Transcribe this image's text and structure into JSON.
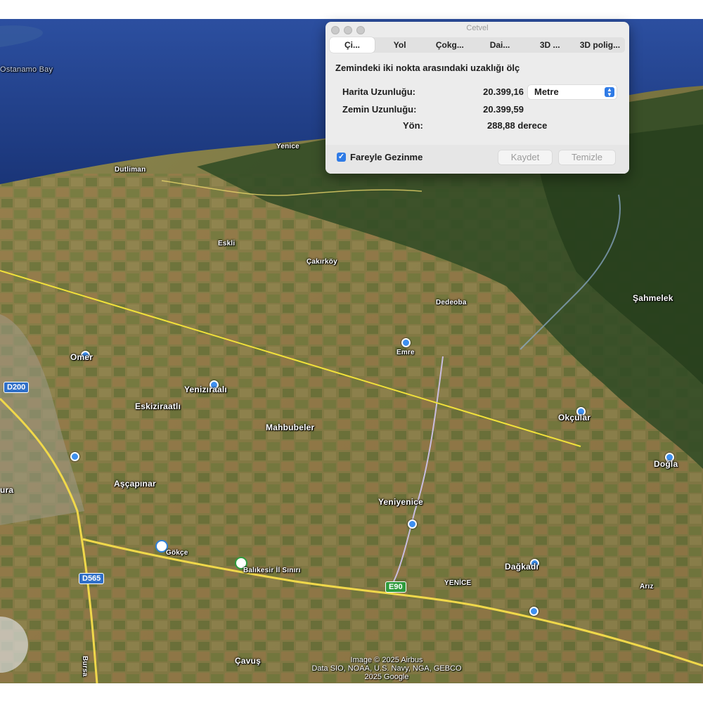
{
  "ruler": {
    "window_title": "Cetvel",
    "tabs": [
      "Çi...",
      "Yol",
      "Çokg...",
      "Dai...",
      "3D ...",
      "3D polig..."
    ],
    "description": "Zemindeki iki nokta arasındaki uzaklığı ölç",
    "map_length_label": "Harita Uzunluğu:",
    "map_length_value": "20.399,16",
    "unit": "Metre",
    "ground_length_label": "Zemin Uzunluğu:",
    "ground_length_value": "20.399,59",
    "heading_label": "Yön:",
    "heading_value": "288,88 derece",
    "mouse_nav_label": "Fareyle Gezinme",
    "mouse_nav_checked": true,
    "save_label": "Kaydet",
    "clear_label": "Temizle"
  },
  "map": {
    "places": {
      "ostanamo_bay": "Ostanamo Bay",
      "dutliman": "Dutliman",
      "yenice_north": "Yenice",
      "eskli": "Eskli",
      "cakirkoy": "Çakırköy",
      "dedeoba": "Dedeoba",
      "sahmelek": "Şahmelek",
      "omer": "Omer",
      "emre": "Emre",
      "yenizirali": "Yenizıraalı",
      "eskizirali": "Eskiziraatlı",
      "mahbubeler": "Mahbubeler",
      "okcular": "Okçular",
      "dogla": "Doğla",
      "ascapinar": "Aşçapınar",
      "yeniyenice": "Yeniyenice",
      "gokce": "Gökçe",
      "balikesir_sinir": "Balıkesir İl Sınırı",
      "dagkadi": "Dağkadı",
      "yenice_town": "YENİCE",
      "ariz": "Arız",
      "cavus": "Çavuş",
      "ura": "ura",
      "bursa": "Bursa"
    },
    "roads": {
      "d200": "D200",
      "d565": "D565",
      "e90": "E90"
    },
    "attribution_line1": "Image © 2025 Airbus",
    "attribution_line2": "Data SIO, NOAA, U.S. Navy, NGA, GEBCO",
    "attribution_line3": "2025 Google",
    "colors": {
      "sea": "#1f3f8a",
      "measure_line": "#f2e23a",
      "road": "#f0d84a",
      "accent": "#2f7be6"
    }
  }
}
